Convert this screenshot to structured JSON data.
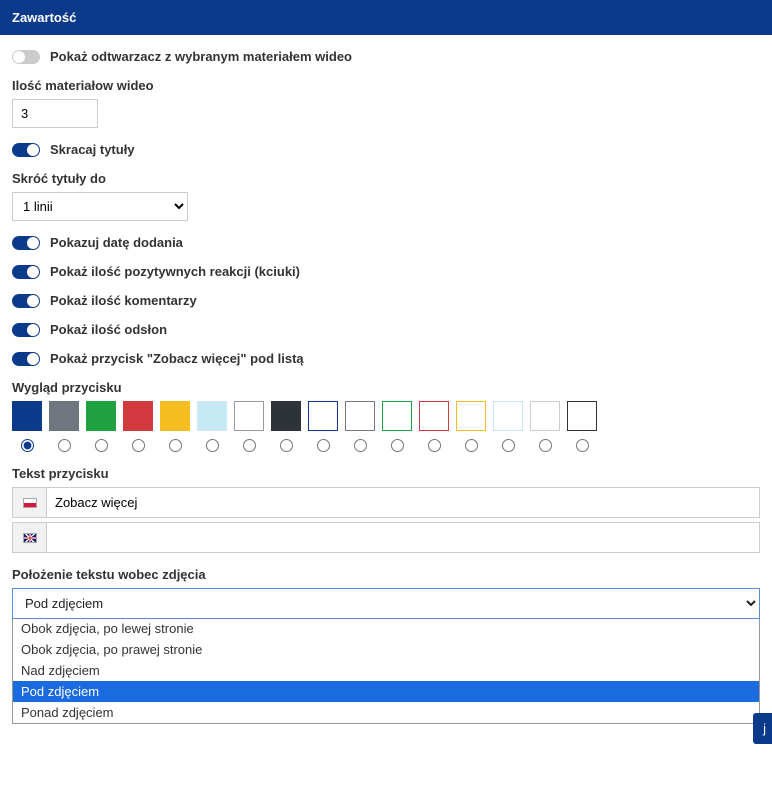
{
  "header": {
    "title": "Zawartość"
  },
  "toggles": {
    "show_player": {
      "label": "Pokaż odtwarzacz z wybranym materiałem wideo",
      "on": false
    },
    "shorten_titles": {
      "label": "Skracaj tytuły",
      "on": true
    },
    "show_date": {
      "label": "Pokazuj datę dodania",
      "on": true
    },
    "show_reactions": {
      "label": "Pokaż ilość pozytywnych reakcji (kciuki)",
      "on": true
    },
    "show_comments": {
      "label": "Pokaż ilość komentarzy",
      "on": true
    },
    "show_views": {
      "label": "Pokaż ilość odsłon",
      "on": true
    },
    "show_more_button": {
      "label": "Pokaż przycisk \"Zobacz więcej\" pod listą",
      "on": true
    }
  },
  "fields": {
    "video_count_label": "Ilość materiałow wideo",
    "video_count_value": "3",
    "shorten_to_label": "Skróć tytuły do",
    "shorten_to_value": "1 linii",
    "button_appearance_label": "Wygląd przycisku",
    "button_text_label": "Tekst przycisku",
    "button_text_pl": "Zobacz więcej",
    "button_text_en": "",
    "text_position_label": "Położenie tekstu wobec zdjęcia",
    "text_position_value": "Pod zdjęciem"
  },
  "swatches": [
    {
      "color": "#0b3a8b",
      "bordered": false
    },
    {
      "color": "#6f7680",
      "bordered": false
    },
    {
      "color": "#1fa13f",
      "bordered": false
    },
    {
      "color": "#d33a3f",
      "bordered": false
    },
    {
      "color": "#f5bd1f",
      "bordered": false
    },
    {
      "color": "#c6e9f5",
      "bordered": false
    },
    {
      "color": "#ffffff",
      "bordered": true
    },
    {
      "color": "#2d3338",
      "bordered": false
    },
    {
      "border_only": "#0b3a8b"
    },
    {
      "border_only": "#6f7680"
    },
    {
      "border_only": "#1fa13f"
    },
    {
      "border_only": "#d33a3f"
    },
    {
      "border_only": "#f5bd1f"
    },
    {
      "border_only": "#c6e9f5"
    },
    {
      "border_only": "#cccccc"
    },
    {
      "border_only": "#2d3338"
    }
  ],
  "swatch_selected_index": 0,
  "dropdown_options": [
    "Obok zdjęcia, po lewej stronie",
    "Obok zdjęcia, po prawej stronie",
    "Nad zdjęciem",
    "Pod zdjęciem",
    "Ponad zdjęciem"
  ],
  "bottom_btn_tail": "j"
}
